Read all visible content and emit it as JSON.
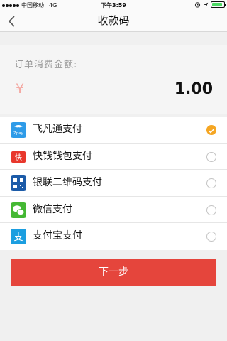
{
  "status_bar": {
    "carrier": "中国移动",
    "network": "4G",
    "time": "下午3:59",
    "battery_percent": 0.85
  },
  "header": {
    "title": "收款码"
  },
  "amount": {
    "label": "订单消费金额:",
    "currency": "¥",
    "value": "1.00"
  },
  "payment_methods": [
    {
      "label": "飞凡通支付",
      "icon": "feifan-pay-icon",
      "color": "#2e9be8",
      "selected": true
    },
    {
      "label": "快钱钱包支付",
      "icon": "kuaiqian-icon",
      "color": "#e8372c",
      "selected": false
    },
    {
      "label": "银联二维码支付",
      "icon": "unionpay-qr-icon",
      "color": "#1c5ba8",
      "selected": false
    },
    {
      "label": "微信支付",
      "icon": "wechat-icon",
      "color": "#44b833",
      "selected": false
    },
    {
      "label": "支付宝支付",
      "icon": "alipay-icon",
      "color": "#1b9ee0",
      "selected": false
    }
  ],
  "next_button": {
    "label": "下一步",
    "color": "#e5453c"
  },
  "accent_color": "#f5a623"
}
